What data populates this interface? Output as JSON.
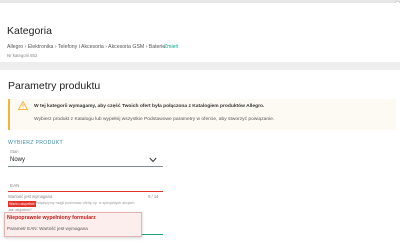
{
  "category": {
    "title": "Kategoria",
    "path": "Allegro › Elektronika › Telefony i Akcesoria › Akcesoria GSM › Baterie",
    "change_link": "Zmień",
    "category_id": "Nr kategorii 552"
  },
  "parameters": {
    "title": "Parametry produktu",
    "notice_strong": "W tej kategorii wymagamy, aby część Twoich ofert była połączona z Katalogiem produktów Allegro.",
    "notice_text": "Wybierz produkt z Katalogu lub wypełnij wszystkie Podstawowe parametry w ofercie, aby stworzyć powiązanie.",
    "section_label": "WYBIERZ PRODUKT",
    "state": {
      "legend": "Stan",
      "value": "Nowy"
    },
    "ean": {
      "placeholder": "EAN",
      "error": "Wartość jest wymagana",
      "counter": "0 / 14",
      "tag": "Warto uzupełnić",
      "tag_description": "Zwiększymy mogli promować ofertę np. w specjalnych akcjach.",
      "link": "Jak uzupełnić?"
    }
  },
  "toast": {
    "title": "Niepoprawnie wypełniony formularz",
    "message": "Parametr EAN: Wartość jest wymagana"
  },
  "colors": {
    "accent": "#00a790",
    "warning": "#f2b63d",
    "error": "#e4322b",
    "section": "#3d8fa8"
  },
  "icons": [
    "warning-icon",
    "chevron-down-icon"
  ]
}
